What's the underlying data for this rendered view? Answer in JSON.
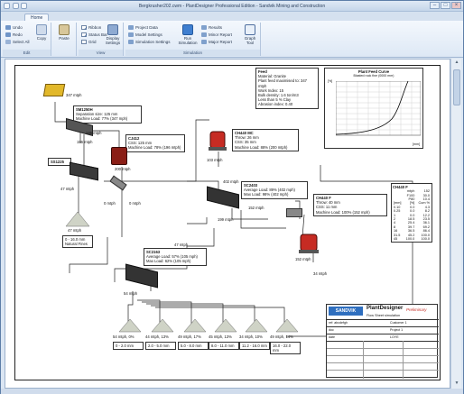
{
  "window": {
    "title": "Bergkrusher202.cwm - PlantDesigner Professional Edition - Sandvik Mining and Construction"
  },
  "tabs": [
    {
      "label": "Home",
      "active": true
    }
  ],
  "ribbon": {
    "edit": {
      "label": "Edit",
      "undo": "Undo",
      "redo": "Redo",
      "select_all": "Select All",
      "copy": "Copy",
      "paste": "Paste"
    },
    "view": {
      "label": "View",
      "ribbon": "Ribbon",
      "status_bar": "Status Bar",
      "grid": "Grid",
      "display_settings": "Display Settings"
    },
    "simulation": {
      "label": "Simulation",
      "project_data": "Project Data",
      "model_settings": "Model Settings",
      "simulation_settings": "Simulation Settings",
      "run_simulation": "Run Simulation",
      "results": "Results",
      "minor_report": "Minor Report",
      "major_report": "Major Report",
      "graph_tool": "Graph Tool"
    }
  },
  "flowsheet": {
    "feed_info": {
      "title": "Feed",
      "lines": [
        "Material: Granite",
        "Plant feed maximised to: 347 mtph",
        "Work Index: 15",
        "Bulk density: 1.6 ton/m3",
        "Less than 5 % Clay",
        "Abrasion index: 0.40"
      ]
    },
    "feed_curve": {
      "title": "Plant Feed Curve",
      "subtitle": "Blasted rock fine (0000 mm)",
      "y_unit": "[%]",
      "x_unit": "[mm]"
    },
    "feed_label": "347 mtph",
    "sm_box": {
      "title": "SM1250H",
      "lines": [
        "Separation size: 125 mm",
        "Machine Load: 77% (347 mph)"
      ]
    },
    "flow_labels": {
      "f1": "146 mtph",
      "f2": "196 mtph",
      "f3": "200 mtph",
      "f4": "47 mtph",
      "f5": "402 mtph",
      "f6": "152 mtph",
      "f7": "199 mtph",
      "f8": "47 mtph",
      "f9": "0 mtph",
      "f10": "0 mtph",
      "f11": "103 mtph",
      "f12": "54 mtph",
      "f13": "152 mtph",
      "f14": "34 mtph"
    },
    "stockpile_left": {
      "tons": "47 mtph",
      "range": "0 - 16.0 mm",
      "name": "Natural Fines"
    },
    "ss_box": {
      "title": "SS1225"
    },
    "cj_box": {
      "title": "CJ412",
      "lines": [
        "CSS: 125 mm",
        "Machine Load: 78% (196 mtph)"
      ]
    },
    "ch_box": {
      "title": "CH440 MC",
      "lines": [
        "Throw: 26 mm",
        "CSS: 35 mm",
        "Machine Load: 88% (200 mtph)"
      ]
    },
    "sc_box1": {
      "title": "SC2403",
      "lines": [
        "Average Load: 89% (402 mph)",
        "Max Load: 98% (402 mph)"
      ]
    },
    "sc_box2": {
      "title": "SC2163",
      "lines": [
        "Average Load: 57% (105 mph)",
        "Max Load: 62% (105 mph)"
      ]
    },
    "ch_box2": {
      "title": "CH440 F",
      "lines": [
        "Throw: 40 mm",
        "CSS: 11 mm",
        "Machine Load: 100% (152 mph)"
      ]
    },
    "grading_table": {
      "title": "CH440 F",
      "rows": [
        [
          "",
          "mtph",
          "152"
        ],
        [
          "",
          "F100",
          "30.0"
        ],
        [
          "",
          "P80",
          "10.4"
        ],
        [
          "[mm]",
          "[%]",
          "Cum %"
        ],
        [
          "0.10",
          "0.0",
          "4.3"
        ],
        [
          "0.25",
          "0.0",
          "8.2"
        ],
        [
          "1",
          "0.0",
          "12.2"
        ],
        [
          "2",
          "18.5",
          "23.5"
        ],
        [
          "4",
          "25.4",
          "36.1"
        ],
        [
          "8",
          "39.7",
          "69.2"
        ],
        [
          "16",
          "36.5",
          "86.4"
        ],
        [
          "31.5",
          "45.2",
          "100.0"
        ],
        [
          "45",
          "100.0",
          "100.0"
        ]
      ]
    },
    "products": [
      {
        "tons": "54 mtph, 0%",
        "range": "0 - 2.0 mm"
      },
      {
        "tons": "44 mtph, 13%",
        "range": "2.0 - 5.0 mm"
      },
      {
        "tons": "49 mtph, 17%",
        "range": "5.0 - 8.0 mm"
      },
      {
        "tons": "45 mtph, 13%",
        "range": "8.0 - 11.0 mm"
      },
      {
        "tons": "34 mtph, 10%",
        "range": "11.2 - 16.0 mm"
      },
      {
        "tons": "49 mtph, 14%",
        "range": "16.0 - 22.0 mm"
      }
    ],
    "title_block": {
      "logo": "SANDVIK",
      "app": "PlantDesigner",
      "tag": "Preliminary",
      "subtitle": "Flow Sheet simulation",
      "rows": [
        [
          "ref: abcdefgh",
          "Customer 1"
        ],
        [
          "doc",
          "Project 1"
        ],
        [
          "date",
          "LOYE"
        ]
      ]
    }
  },
  "colors": {
    "accent": "#2f6fbf",
    "feeder": "#e2b82a",
    "crusher_red": "#c62b23"
  }
}
